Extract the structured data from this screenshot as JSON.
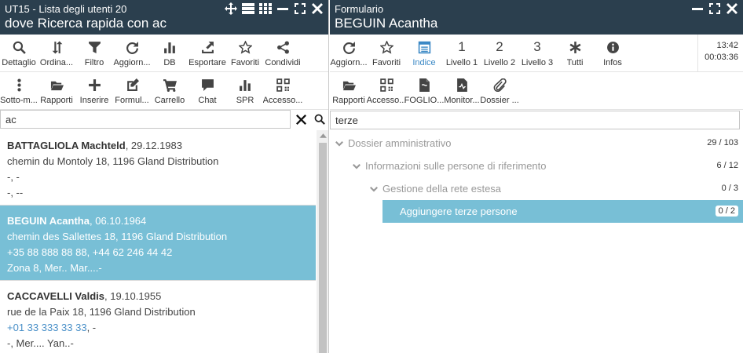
{
  "left": {
    "title_line1": "UT15 - Lista degli utenti 20",
    "title_line2": "dove Ricerca rapida con ac",
    "toolbar1": [
      {
        "label": "Dettaglio",
        "icon": "search-icon"
      },
      {
        "label": "Ordina...",
        "icon": "sort-icon"
      },
      {
        "label": "Filtro",
        "icon": "filter-icon"
      },
      {
        "label": "Aggiorn...",
        "icon": "refresh-icon"
      },
      {
        "label": "DB",
        "icon": "bar-chart-icon"
      },
      {
        "label": "Esportare",
        "icon": "export-icon"
      },
      {
        "label": "Favoriti",
        "icon": "star-icon"
      },
      {
        "label": "Condividi",
        "icon": "share-icon"
      }
    ],
    "toolbar2": [
      {
        "label": "Sotto-m...",
        "icon": "vertical-dots-icon"
      },
      {
        "label": "Rapporti",
        "icon": "folder-open-icon"
      },
      {
        "label": "Inserire",
        "icon": "plus-icon"
      },
      {
        "label": "Formul...",
        "icon": "edit-form-icon"
      },
      {
        "label": "Carrello",
        "icon": "cart-icon"
      },
      {
        "label": "Chat",
        "icon": "chat-icon"
      },
      {
        "label": "SPR",
        "icon": "bar-chart-icon"
      },
      {
        "label": "Accesso...",
        "icon": "qr-code-icon"
      }
    ],
    "search_value": "ac",
    "users": [
      {
        "name": "BATTAGLIOLA Machteld",
        "date": ", 29.12.1983",
        "address": "chemin du Montoly 18, 1196 Gland Distribution",
        "phone": "",
        "phone_rest": "-, -",
        "note": "-, --",
        "selected": false
      },
      {
        "name": "BEGUIN Acantha",
        "date": ", 06.10.1964",
        "address": "chemin des Sallettes 18, 1196 Gland Distribution",
        "phone": "",
        "phone_rest": "+35 88 888 88 88, +44 62 246 44 42",
        "note": "Zona 8, Mer.. Mar....-",
        "selected": true
      },
      {
        "name": "CACCAVELLI Valdis",
        "date": ", 19.10.1955",
        "address": "rue de la Paix 18, 1196 Gland Distribution",
        "phone": "+01 33 333 33 33",
        "phone_rest": ", -",
        "note": "-, Mer.... Yan..-",
        "selected": false
      }
    ]
  },
  "right": {
    "title_line1": "Formulario",
    "title_line2": "BEGUIN Acantha",
    "toolbar1": [
      {
        "label": "Aggiorn...",
        "icon": "refresh-icon"
      },
      {
        "label": "Favoriti",
        "icon": "star-icon"
      },
      {
        "label": "Indice",
        "icon": "index-icon",
        "active": true
      },
      {
        "label": "Livello 1",
        "num": "1"
      },
      {
        "label": "Livello 2",
        "num": "2"
      },
      {
        "label": "Livello 3",
        "num": "3"
      },
      {
        "label": "Tutti",
        "icon": "asterisk-icon"
      },
      {
        "label": "Infos",
        "icon": "info-icon"
      }
    ],
    "time": "13:42",
    "elapsed": "00:03:36",
    "toolbar2": [
      {
        "label": "Rapporti",
        "icon": "folder-open-icon"
      },
      {
        "label": "Accesso...",
        "icon": "qr-code-icon"
      },
      {
        "label": "FOGLIO...",
        "icon": "document-icon"
      },
      {
        "label": "Monitor...",
        "icon": "monitor-doc-icon"
      },
      {
        "label": "Dossier ...",
        "icon": "paperclip-icon"
      }
    ],
    "search_value": "terze",
    "tree": [
      {
        "label": "Dossier amministrativo",
        "count": "29 / 103",
        "level": 0,
        "selected": false
      },
      {
        "label": "Informazioni sulle persone di riferimento",
        "count": "6 / 12",
        "level": 1,
        "selected": false
      },
      {
        "label": "Gestione della rete estesa",
        "count": "0 / 3",
        "level": 2,
        "selected": false
      },
      {
        "label": "Aggiungere terze persone",
        "count": "0 / 2",
        "level": 3,
        "selected": true
      }
    ]
  },
  "colors": {
    "titlebar": "#2b3f4e",
    "selection": "#78bfd6",
    "accent": "#3a88c5"
  }
}
